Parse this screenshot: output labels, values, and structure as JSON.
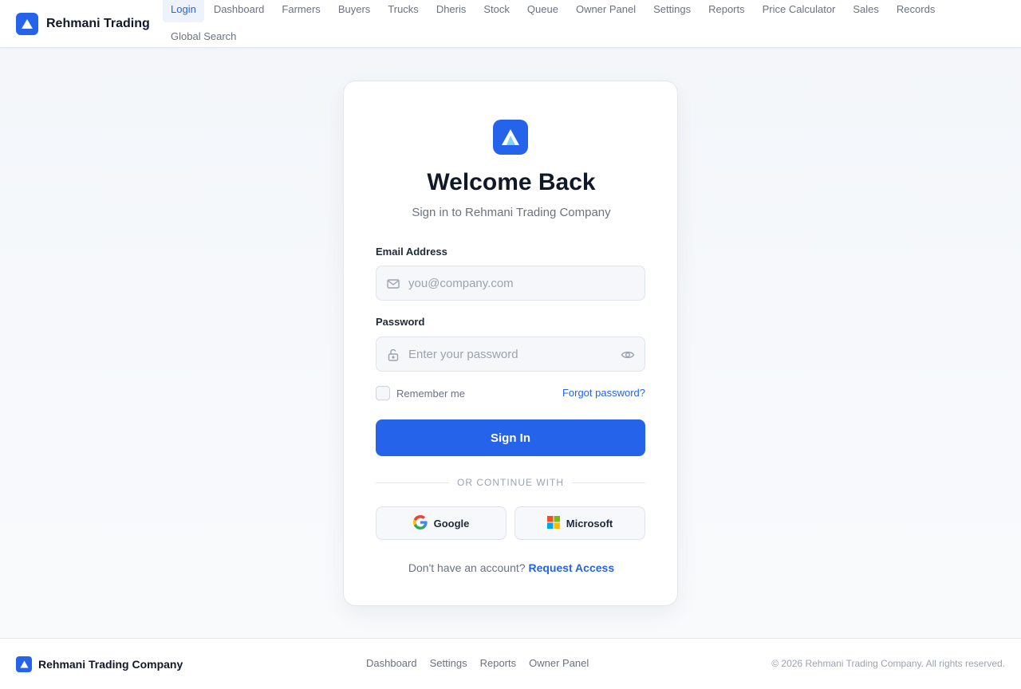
{
  "app": {
    "brand_name": "Rehmani Trading",
    "logo_icon": "mountain-logo-icon",
    "accent_color": "#2563eb"
  },
  "nav": {
    "items": [
      {
        "label": "Login",
        "active": true
      },
      {
        "label": "Dashboard"
      },
      {
        "label": "Farmers"
      },
      {
        "label": "Buyers"
      },
      {
        "label": "Trucks"
      },
      {
        "label": "Dheris"
      },
      {
        "label": "Stock"
      },
      {
        "label": "Queue"
      },
      {
        "label": "Owner Panel"
      },
      {
        "label": "Settings"
      },
      {
        "label": "Reports"
      },
      {
        "label": "Price Calculator"
      },
      {
        "label": "Sales"
      },
      {
        "label": "Records"
      },
      {
        "label": "Global Search"
      }
    ]
  },
  "login": {
    "title": "Welcome Back",
    "subtitle": "Sign in to Rehmani Trading Company",
    "email": {
      "label": "Email Address",
      "placeholder": "you@company.com",
      "value": "",
      "icon": "mail-icon"
    },
    "password": {
      "label": "Password",
      "placeholder": "Enter your password",
      "value": "",
      "icon": "lock-icon",
      "toggle_icon": "eye-icon"
    },
    "remember_label": "Remember me",
    "remember_checked": false,
    "forgot_label": "Forgot password?",
    "submit_label": "Sign In",
    "divider_text": "OR CONTINUE WITH",
    "social": {
      "google_label": "Google",
      "microsoft_label": "Microsoft"
    },
    "no_account_text": "Don't have an account?",
    "request_access_label": "Request Access"
  },
  "footer": {
    "company_name": "Rehmani Trading Company",
    "links": [
      "Dashboard",
      "Settings",
      "Reports",
      "Owner Panel"
    ],
    "copyright": "© 2026 Rehmani Trading Company. All rights reserved."
  }
}
